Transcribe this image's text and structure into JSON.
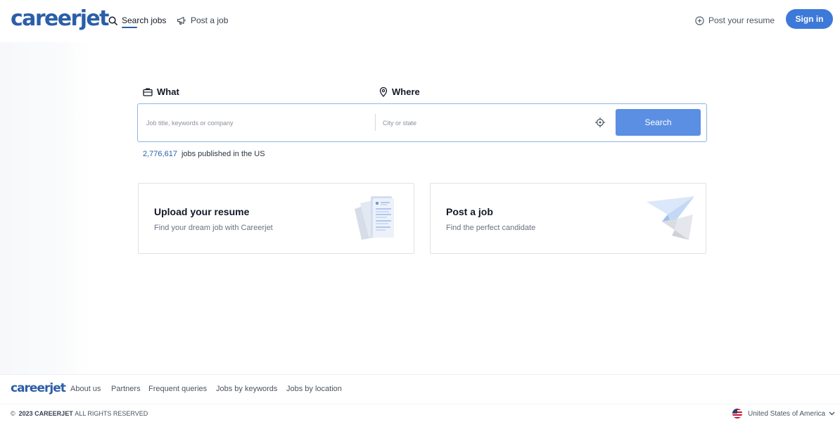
{
  "header": {
    "logo": "careerjet",
    "nav": {
      "search_jobs": "Search jobs",
      "post_job": "Post a job",
      "post_resume": "Post your resume"
    },
    "sign_in": "Sign in"
  },
  "search": {
    "what_label": "What",
    "where_label": "Where",
    "what_placeholder": "Job title, keywords or company",
    "where_placeholder": "City or state",
    "button": "Search",
    "jobs_count": "2,776,617",
    "jobs_text": "jobs published in the US"
  },
  "cards": {
    "resume": {
      "title": "Upload your resume",
      "subtitle": "Find your dream job with Careerjet",
      "icon": "resume-illustration"
    },
    "post": {
      "title": "Post a job",
      "subtitle": "Find the perfect candidate",
      "icon": "paper-plane-illustration"
    }
  },
  "footer": {
    "logo": "careerjet",
    "links": [
      "About us",
      "Partners",
      "Frequent queries",
      "Jobs by keywords",
      "Jobs by location"
    ],
    "copyright_symbol": "©",
    "copyright_year_brand": "2023 CAREERJET",
    "copyright_rest": "ALL RIGHTS RESERVED",
    "country": "United States of America"
  },
  "colors": {
    "brand": "#2b5ea8",
    "button": "#5b8fe3",
    "signin": "#3d79d8"
  }
}
